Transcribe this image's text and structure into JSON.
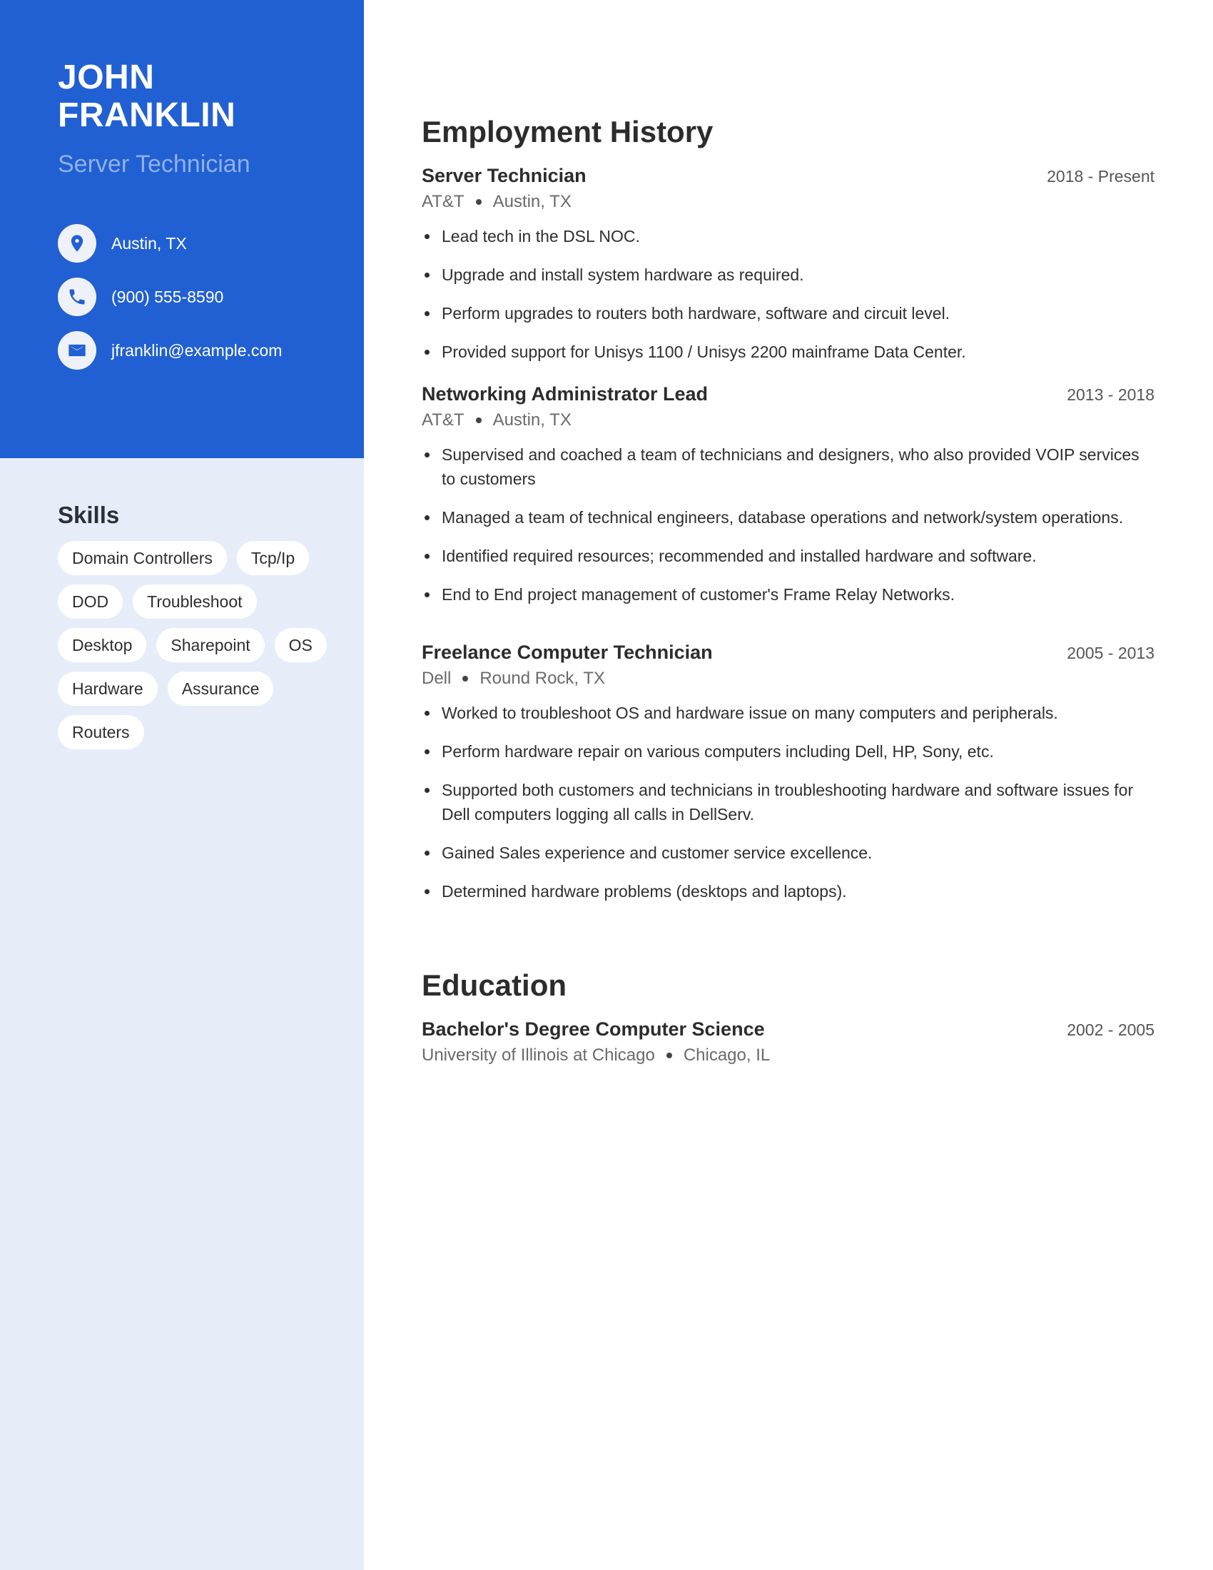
{
  "profile": {
    "first_name": "JOHN",
    "last_name": "FRANKLIN",
    "title": "Server Technician"
  },
  "contact": [
    {
      "icon": "location-pin-icon",
      "text": "Austin, TX"
    },
    {
      "icon": "phone-icon",
      "text": "(900) 555-8590"
    },
    {
      "icon": "mail-icon",
      "text": "jfranklin@example.com"
    }
  ],
  "skills": {
    "title": "Skills",
    "items": [
      "Domain Controllers",
      "Tcp/Ip",
      "DOD",
      "Troubleshoot",
      "Desktop",
      "Sharepoint",
      "OS",
      "Hardware",
      "Assurance",
      "Routers"
    ]
  },
  "employment": {
    "title": "Employment History",
    "jobs": [
      {
        "title": "Server Technician",
        "dates": "2018 - Present",
        "company": "AT&T",
        "location": "Austin, TX",
        "bullets": [
          "Lead tech in the DSL NOC.",
          "Upgrade and install system hardware as required.",
          "Perform upgrades to routers both hardware, software and circuit level.",
          "Provided support for Unisys 1100 / Unisys 2200 mainframe Data Center."
        ]
      },
      {
        "title": "Networking Administrator Lead",
        "dates": "2013 - 2018",
        "company": "AT&T",
        "location": "Austin, TX",
        "bullets": [
          "Supervised and coached a team of technicians and designers, who also provided VOIP services to customers",
          "Managed a team of technical engineers, database operations and network/system operations.",
          "Identified required resources; recommended and installed hardware and software.",
          "End to End project management of customer's Frame Relay Networks."
        ]
      },
      {
        "title": "Freelance Computer Technician",
        "dates": "2005 - 2013",
        "company": "Dell",
        "location": "Round Rock, TX",
        "bullets": [
          "Worked to troubleshoot OS and hardware issue on many computers and peripherals.",
          "Perform hardware repair on various computers including Dell, HP, Sony, etc.",
          "Supported both customers and technicians in troubleshooting hardware and software issues for Dell computers logging all calls in DellServ.",
          "Gained Sales experience and customer service excellence.",
          "Determined hardware problems (desktops and laptops)."
        ]
      }
    ]
  },
  "education": {
    "title": "Education",
    "items": [
      {
        "degree": "Bachelor's Degree Computer Science",
        "dates": "2002 - 2005",
        "school": "University of Illinois at Chicago",
        "location": "Chicago, IL"
      }
    ]
  },
  "colors": {
    "accent": "#2160d2",
    "sidebar_bg": "#e6edf9",
    "title_muted": "#8fb0ea"
  }
}
